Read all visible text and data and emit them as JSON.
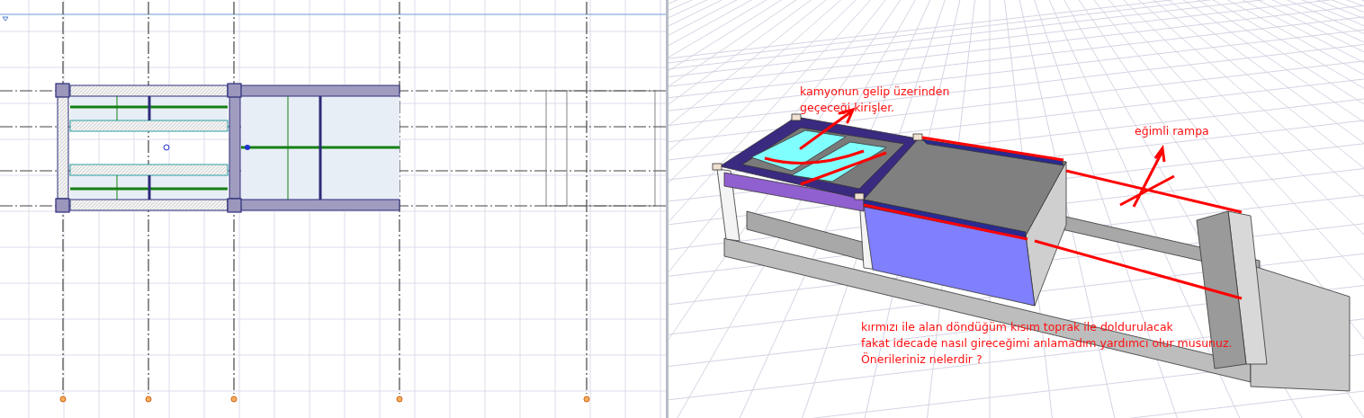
{
  "model_view": {
    "annotations": [
      {
        "lines": [
          "kamyonun gelip üzerinden",
          "geçeceği kirişler."
        ]
      },
      {
        "lines": [
          "eğimli rampa"
        ]
      },
      {
        "lines": [
          "kırmızı ile alan döndüğüm kısım toprak ile doldurulacak",
          "fakat idecade nasıl gireceğimi anlamadım yardımcı olur musunuz.",
          "Önerileriniz nelerdir ?"
        ]
      }
    ]
  }
}
